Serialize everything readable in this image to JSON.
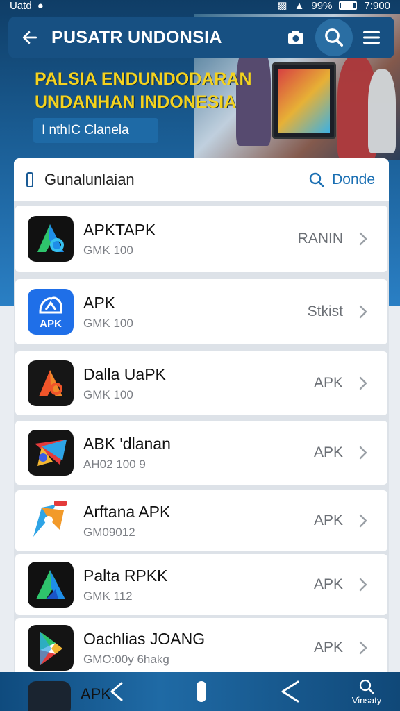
{
  "status_bar": {
    "carrier": "Uatd",
    "battery": "99%",
    "time": "7:900"
  },
  "app_bar": {
    "title": "PUSATR UNDONSIA",
    "back_icon": "back-arrow-icon",
    "camera_icon": "camera-icon",
    "search_icon": "search-icon",
    "menu_icon": "menu-icon"
  },
  "hero": {
    "title_line1": "PALSIA ENDUNDODARAN",
    "title_line2": "UNDANHAN INDONESIA",
    "chip_label": "I nthIC Clanela"
  },
  "list_header": {
    "label": "Gunalunlaian",
    "action_label": "Donde",
    "action_icon": "search-icon"
  },
  "items": [
    {
      "name": "APKTAPK",
      "sub": "GMK 100",
      "tag": "RANIN"
    },
    {
      "name": "APK",
      "sub": "GMK 100",
      "tag": "Stkist"
    },
    {
      "name": "Dalla UaPK",
      "sub": "GMK 100",
      "tag": "APK"
    },
    {
      "name": "ABK 'dlanan",
      "sub": "AH02 100        9",
      "tag": "APK"
    },
    {
      "name": "Arftana APK",
      "sub": "GM09012",
      "tag": "APK"
    },
    {
      "name": "Palta RPKK",
      "sub": "GMK 112",
      "tag": "APK"
    },
    {
      "name": "Oachlias JOANG",
      "sub": "GMO:00y 6hakg",
      "tag": "APK"
    }
  ],
  "partial_item": {
    "name": "APK"
  },
  "icon_labels": {
    "apk_badge": "APK"
  },
  "bottom_nav": {
    "back_icon": "back-chevron-icon",
    "home_icon": "home-pill-icon",
    "recent_icon": "back-chevron-icon",
    "search_label": "Vinsaty",
    "search_icon": "search-icon"
  },
  "colors": {
    "accent": "#175082",
    "title_yellow": "#f4d21f",
    "link_blue": "#1a6fb3"
  }
}
